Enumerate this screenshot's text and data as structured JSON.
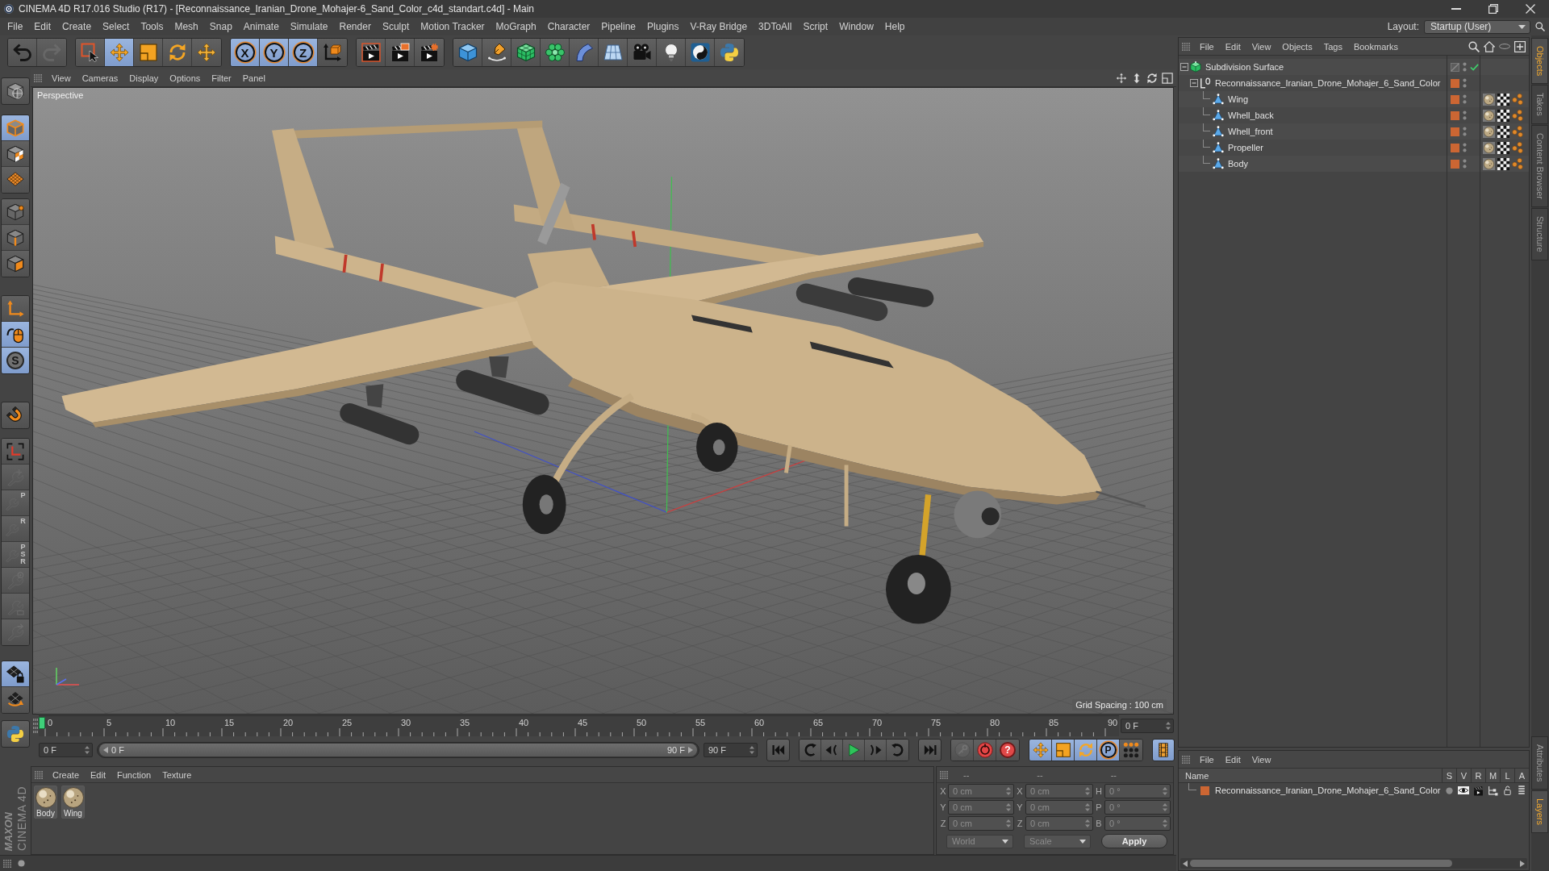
{
  "window": {
    "title": "CINEMA 4D R17.016 Studio (R17) - [Reconnaissance_Iranian_Drone_Mohajer-6_Sand_Color_c4d_standart.c4d] - Main"
  },
  "menu": [
    "File",
    "Edit",
    "Create",
    "Select",
    "Tools",
    "Mesh",
    "Snap",
    "Animate",
    "Simulate",
    "Render",
    "Sculpt",
    "Motion Tracker",
    "MoGraph",
    "Character",
    "Pipeline",
    "Plugins",
    "V-Ray Bridge",
    "3DToAll",
    "Script",
    "Window",
    "Help"
  ],
  "layout": {
    "label": "Layout:",
    "value": "Startup (User)"
  },
  "toolbar": [
    {
      "tools": [
        {
          "kind": "undo",
          "disabled": false
        },
        {
          "kind": "redo",
          "disabled": true
        }
      ]
    },
    {
      "tools": [
        {
          "kind": "select",
          "selected": false
        },
        {
          "kind": "move",
          "selected": true
        },
        {
          "kind": "scale",
          "selected": false
        },
        {
          "kind": "rotate",
          "selected": false
        },
        {
          "kind": "lasttool",
          "selected": false
        }
      ]
    },
    {
      "tools": [
        {
          "kind": "axis",
          "label": "X",
          "selected": true
        },
        {
          "kind": "axis",
          "label": "Y",
          "selected": true
        },
        {
          "kind": "axis",
          "label": "Z",
          "selected": true
        },
        {
          "kind": "coords",
          "selected": false
        }
      ]
    },
    {
      "tools": [
        {
          "kind": "renderview"
        },
        {
          "kind": "renderpicture"
        },
        {
          "kind": "rendersettings"
        }
      ]
    },
    {
      "tools": [
        {
          "kind": "cube"
        },
        {
          "kind": "pen"
        },
        {
          "kind": "subdivision"
        },
        {
          "kind": "cloner"
        },
        {
          "kind": "bend"
        },
        {
          "kind": "floor"
        },
        {
          "kind": "camera"
        },
        {
          "kind": "light"
        },
        {
          "kind": "plugin"
        },
        {
          "kind": "python"
        }
      ]
    }
  ],
  "left_tools": [
    {
      "tools": [
        {
          "kind": "editable",
          "selected": false
        }
      ]
    },
    {
      "tools": [
        {
          "kind": "model",
          "selected": true
        },
        {
          "kind": "texture",
          "selected": false
        },
        {
          "kind": "workplane",
          "selected": false
        }
      ]
    },
    {
      "tools": [
        {
          "kind": "points",
          "selected": false
        },
        {
          "kind": "edges",
          "selected": false
        },
        {
          "kind": "polygons",
          "selected": false
        }
      ]
    },
    {
      "tools": [
        {
          "kind": "axismode",
          "selected": false
        },
        {
          "kind": "tweak",
          "selected": true
        },
        {
          "kind": "solo",
          "label": "S",
          "selected": true
        }
      ]
    },
    {
      "tools": [
        {
          "kind": "magnet",
          "selected": false
        }
      ]
    },
    {
      "tools": [
        {
          "kind": "wpaxis",
          "disabled": false
        },
        {
          "kind": "lockmove",
          "disabled": true
        },
        {
          "kind": "lockletter",
          "label": "P",
          "disabled": true
        },
        {
          "kind": "lockletter",
          "label": "R",
          "disabled": true
        },
        {
          "kind": "lockletter",
          "label": "PSR",
          "disabled": true
        },
        {
          "kind": "locktarget",
          "disabled": true
        },
        {
          "kind": "lockframe",
          "disabled": true
        },
        {
          "kind": "lockarrow",
          "disabled": true
        }
      ]
    },
    {
      "tools": [
        {
          "kind": "gridlock",
          "selected": true
        },
        {
          "kind": "gridrotate",
          "selected": false
        }
      ]
    },
    {
      "tools": [
        {
          "kind": "python",
          "selected": false
        }
      ]
    }
  ],
  "viewport": {
    "menu": [
      "View",
      "Cameras",
      "Display",
      "Options",
      "Filter",
      "Panel"
    ],
    "camera": "Perspective",
    "grid_spacing": "Grid Spacing : 100 cm"
  },
  "timeline": {
    "ticks": [
      "0",
      "5",
      "10",
      "15",
      "20",
      "25",
      "30",
      "35",
      "40",
      "45",
      "50",
      "55",
      "60",
      "65",
      "70",
      "75",
      "80",
      "85",
      "90"
    ],
    "playhead": {
      "level": 0
    },
    "frame": "0 F"
  },
  "playback": {
    "start": "0 F",
    "range": {
      "start": "0 F",
      "end": "90 F",
      "level": 1
    },
    "end": "90 F",
    "transport": [
      [
        {
          "kind": "first"
        }
      ],
      [
        {
          "kind": "prevkey"
        },
        {
          "kind": "prevframe"
        },
        {
          "kind": "play"
        },
        {
          "kind": "nextframe"
        },
        {
          "kind": "nextkey"
        }
      ],
      [
        {
          "kind": "last"
        }
      ]
    ],
    "record": [
      {
        "kind": "key",
        "disabled": true
      },
      {
        "kind": "autokey",
        "disabled": false
      },
      {
        "kind": "help",
        "label": "?",
        "disabled": false
      }
    ],
    "keys": [
      {
        "kind": "poskey",
        "selected": true
      },
      {
        "kind": "scalekey",
        "selected": true
      },
      {
        "kind": "rotkey",
        "selected": true
      },
      {
        "kind": "paramkey",
        "label": "P",
        "selected": true
      },
      {
        "kind": "plakey",
        "selected": false
      }
    ],
    "timeline_button": {
      "kind": "timeline",
      "selected": true
    }
  },
  "materials": {
    "menu": [
      "Create",
      "Edit",
      "Function",
      "Texture"
    ],
    "items": [
      {
        "name": "Body"
      },
      {
        "name": "Wing"
      }
    ]
  },
  "coordinates": {
    "headers": [
      "--",
      "--",
      "--"
    ],
    "rows": [
      {
        "position_label": "X",
        "position": "0 cm",
        "size_label": "X",
        "size": "0 cm",
        "rotation_label": "H",
        "rotation": "0 °"
      },
      {
        "position_label": "Y",
        "position": "0 cm",
        "size_label": "Y",
        "size": "0 cm",
        "rotation_label": "P",
        "rotation": "0 °"
      },
      {
        "position_label": "Z",
        "position": "0 cm",
        "size_label": "Z",
        "size": "0 cm",
        "rotation_label": "B",
        "rotation": "0 °"
      }
    ],
    "mode": "World",
    "size_mode": "Scale",
    "apply": "Apply"
  },
  "objects": {
    "menu": [
      "File",
      "Edit",
      "View",
      "Objects",
      "Tags",
      "Bookmarks"
    ],
    "tree": [
      {
        "name": "Subdivision Surface",
        "kind": "subdivision",
        "expanded": true,
        "enabled": true,
        "children": [
          {
            "name": "Reconnaissance_Iranian_Drone_Mohajer_6_Sand_Color",
            "kind": "null",
            "expanded": true,
            "color": "#cc6633",
            "children": [
              {
                "name": "Wing",
                "kind": "polygon",
                "color": "#cc6633",
                "tags": [
                  {
                    "kind": "material"
                  },
                  {
                    "kind": "uvw"
                  },
                  {
                    "kind": "phong"
                  }
                ]
              },
              {
                "name": "Whell_back",
                "kind": "polygon",
                "color": "#cc6633",
                "tags": [
                  {
                    "kind": "material"
                  },
                  {
                    "kind": "uvw"
                  },
                  {
                    "kind": "phong"
                  }
                ]
              },
              {
                "name": "Whell_front",
                "kind": "polygon",
                "color": "#cc6633",
                "tags": [
                  {
                    "kind": "material"
                  },
                  {
                    "kind": "uvw"
                  },
                  {
                    "kind": "phong"
                  }
                ]
              },
              {
                "name": "Propeller",
                "kind": "polygon",
                "color": "#cc6633",
                "tags": [
                  {
                    "kind": "material"
                  },
                  {
                    "kind": "uvw"
                  },
                  {
                    "kind": "phong"
                  }
                ]
              },
              {
                "name": "Body",
                "kind": "polygon",
                "color": "#cc6633",
                "tags": [
                  {
                    "kind": "material"
                  },
                  {
                    "kind": "uvw"
                  },
                  {
                    "kind": "phong"
                  }
                ]
              }
            ]
          }
        ]
      }
    ]
  },
  "layers": {
    "menu": [
      "File",
      "Edit",
      "View"
    ],
    "columns": [
      "Name",
      "S",
      "V",
      "R",
      "M",
      "L",
      "A"
    ],
    "rows": [
      {
        "name": "Reconnaissance_Iranian_Drone_Mohajer_6_Sand_Color",
        "color": "#cc6633"
      }
    ]
  },
  "side_tabs": {
    "top": [
      {
        "label": "Objects",
        "selected": true
      },
      {
        "label": "Takes",
        "selected": false
      },
      {
        "label": "Content Browser",
        "selected": false
      },
      {
        "label": "Structure",
        "selected": false
      }
    ],
    "bottom": [
      {
        "label": "Attributes",
        "selected": false
      },
      {
        "label": "Layers",
        "selected": true
      }
    ]
  },
  "branding": {
    "company": "MAXON",
    "product": "CINEMA 4D"
  }
}
